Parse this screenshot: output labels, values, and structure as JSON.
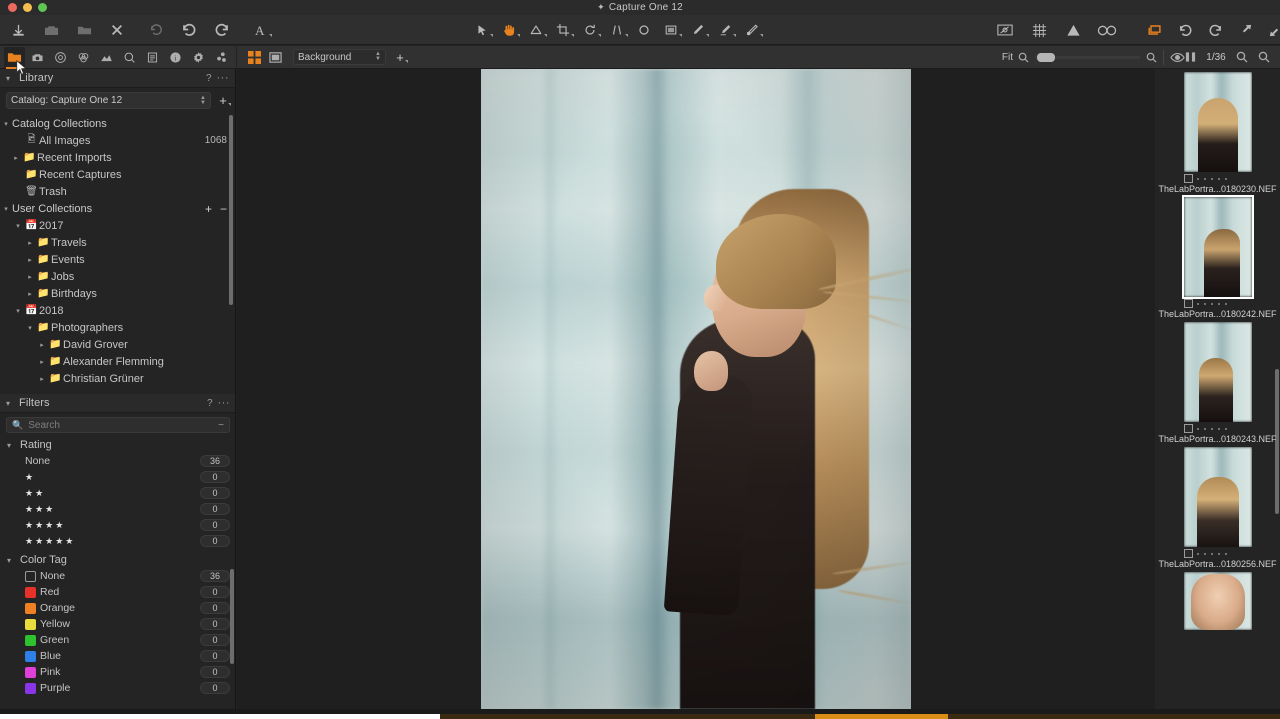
{
  "window": {
    "title": "Capture One 12",
    "title_icon": "capture-one-icon"
  },
  "toolbar": {
    "left": [
      {
        "name": "import-icon",
        "label": "Import Images"
      },
      {
        "name": "camera-icon",
        "label": "Capture"
      },
      {
        "name": "folder-open-icon",
        "label": "Open Folder"
      },
      {
        "name": "close-x-icon",
        "label": "Close"
      },
      {
        "name": "undo-all-icon",
        "label": "Undo All"
      },
      {
        "name": "undo-icon",
        "label": "Undo"
      },
      {
        "name": "redo-icon",
        "label": "Redo"
      },
      {
        "name": "text-tool-icon",
        "label": "Annotations"
      }
    ],
    "center": [
      {
        "name": "select-pointer-icon",
        "label": "Select"
      },
      {
        "name": "pan-hand-icon",
        "label": "Pan",
        "active": true
      },
      {
        "name": "white-balance-icon",
        "label": "White Balance"
      },
      {
        "name": "crop-icon",
        "label": "Crop"
      },
      {
        "name": "rotate-icon",
        "label": "Rotate"
      },
      {
        "name": "keystone-icon",
        "label": "Keystone"
      },
      {
        "name": "spot-removal-icon",
        "label": "Spot Removal"
      },
      {
        "name": "gradient-mask-icon",
        "label": "Gradient Mask"
      },
      {
        "name": "draw-mask-icon",
        "label": "Draw Mask"
      },
      {
        "name": "erase-mask-icon",
        "label": "Erase Mask"
      },
      {
        "name": "heal-brush-icon",
        "label": "Heal Brush"
      }
    ],
    "right": [
      {
        "name": "proof-preview-icon",
        "label": "Proof Profile"
      },
      {
        "name": "grid-overlay-icon",
        "label": "Grid"
      },
      {
        "name": "exposure-warning-icon",
        "label": "Exposure Warning"
      },
      {
        "name": "focus-mask-icon",
        "label": "Focus Mask"
      }
    ],
    "right2": [
      {
        "name": "layers-icon",
        "label": "Layers",
        "active": true
      },
      {
        "name": "rotate-left-icon",
        "label": "Rotate Left"
      },
      {
        "name": "rotate-right-icon",
        "label": "Rotate Right"
      },
      {
        "name": "expand-icon",
        "label": "Expand"
      },
      {
        "name": "collapse-icon",
        "label": "Collapse"
      }
    ]
  },
  "tool_tabs": [
    {
      "name": "tab-library",
      "label": "Library",
      "icon": "folder-icon",
      "active": true
    },
    {
      "name": "tab-capture",
      "label": "Capture",
      "icon": "camera-icon"
    },
    {
      "name": "tab-lens",
      "label": "Lens",
      "icon": "lens-icon"
    },
    {
      "name": "tab-color",
      "label": "Color",
      "icon": "color-wheel-icon"
    },
    {
      "name": "tab-exposure",
      "label": "Exposure",
      "icon": "exposure-icon"
    },
    {
      "name": "tab-details",
      "label": "Details",
      "icon": "magnifier-icon"
    },
    {
      "name": "tab-adjustments",
      "label": "Adjustments",
      "icon": "adjustments-icon"
    },
    {
      "name": "tab-metadata",
      "label": "Metadata",
      "icon": "info-icon"
    },
    {
      "name": "tab-output",
      "label": "Output",
      "icon": "gear-icon"
    },
    {
      "name": "tab-batch",
      "label": "Batch",
      "icon": "batch-icon"
    }
  ],
  "library": {
    "panel_title": "Library",
    "help_icon": "?",
    "menu_icon": "···",
    "catalog_selector": "Catalog: Capture One 12",
    "add_label": "+",
    "catalog_collections": {
      "label": "Catalog Collections",
      "items": [
        {
          "label": "All Images",
          "count": "1068",
          "icon": "images-icon",
          "disclosure": ""
        },
        {
          "label": "Recent Imports",
          "count": "",
          "icon": "folder-icon",
          "disclosure": "›"
        },
        {
          "label": "Recent Captures",
          "count": "",
          "icon": "folder-icon",
          "disclosure": ""
        },
        {
          "label": "Trash",
          "count": "",
          "icon": "trash-icon",
          "disclosure": ""
        }
      ]
    },
    "user_collections": {
      "label": "User Collections",
      "add_label": "+",
      "remove_label": "−",
      "items": [
        {
          "label": "2017",
          "icon": "album-icon",
          "disclosure": "⌄",
          "indent": 1
        },
        {
          "label": "Travels",
          "icon": "folder-icon",
          "disclosure": "›",
          "indent": 2
        },
        {
          "label": "Events",
          "icon": "folder-icon",
          "disclosure": "›",
          "indent": 2
        },
        {
          "label": "Jobs",
          "icon": "folder-icon",
          "disclosure": "›",
          "indent": 2
        },
        {
          "label": "Birthdays",
          "icon": "folder-icon",
          "disclosure": "›",
          "indent": 2
        },
        {
          "label": "2018",
          "icon": "album-icon",
          "disclosure": "⌄",
          "indent": 1
        },
        {
          "label": "Photographers",
          "icon": "folder-icon",
          "disclosure": "⌄",
          "indent": 2
        },
        {
          "label": "David Grover",
          "icon": "folder-icon",
          "disclosure": "›",
          "indent": 3
        },
        {
          "label": "Alexander Flemming",
          "icon": "folder-icon",
          "disclosure": "›",
          "indent": 3
        },
        {
          "label": "Christian Grüner",
          "icon": "folder-icon",
          "disclosure": "›",
          "indent": 3
        }
      ]
    }
  },
  "filters": {
    "panel_title": "Filters",
    "help_icon": "?",
    "menu_icon": "···",
    "search_placeholder": "Search",
    "search_value": "",
    "search_menu": "−",
    "rating": {
      "label": "Rating",
      "rows": [
        {
          "label": "None",
          "stars": 0,
          "count": "36"
        },
        {
          "label": "",
          "stars": 1,
          "count": "0"
        },
        {
          "label": "",
          "stars": 2,
          "count": "0"
        },
        {
          "label": "",
          "stars": 3,
          "count": "0"
        },
        {
          "label": "",
          "stars": 4,
          "count": "0"
        },
        {
          "label": "",
          "stars": 5,
          "count": "0"
        }
      ]
    },
    "color_tag": {
      "label": "Color Tag",
      "rows": [
        {
          "label": "None",
          "color": "none",
          "count": "36"
        },
        {
          "label": "Red",
          "color": "#e8312a",
          "count": "0"
        },
        {
          "label": "Orange",
          "color": "#ef8023",
          "count": "0"
        },
        {
          "label": "Yellow",
          "color": "#e9dd3d",
          "count": "0"
        },
        {
          "label": "Green",
          "color": "#2fc22f",
          "count": "0"
        },
        {
          "label": "Blue",
          "color": "#2f7fe8",
          "count": "0"
        },
        {
          "label": "Pink",
          "color": "#e03fd8",
          "count": "0"
        },
        {
          "label": "Purple",
          "color": "#8a35e8",
          "count": "0"
        }
      ]
    }
  },
  "browser_bar": {
    "grid_view_icon": "grid-view-icon",
    "single_view_icon": "single-view-icon",
    "background_select": "Background",
    "add_label": "+",
    "fit_label": "Fit",
    "zoom_out_icon": "zoom-out-icon",
    "zoom_in_icon": "zoom-in-icon",
    "preview_icon": "eye-icon",
    "compare_icon": "compare-icon",
    "counter": "1/36",
    "search_icon": "search-icon",
    "zoom_search_icon": "zoom-search-icon"
  },
  "filmstrip": {
    "thumbnails": [
      {
        "label": "TheLabPortra...0180230.NEF",
        "selected": false,
        "variant": "front-face"
      },
      {
        "label": "TheLabPortra...0180242.NEF",
        "selected": true,
        "variant": "profile-left"
      },
      {
        "label": "TheLabPortra...0180243.NEF",
        "selected": false,
        "variant": "profile-right"
      },
      {
        "label": "TheLabPortra...0180256.NEF",
        "selected": false,
        "variant": "back-head"
      },
      {
        "label": "",
        "selected": false,
        "variant": "closeup"
      }
    ]
  },
  "accent_color": "#e8821e"
}
